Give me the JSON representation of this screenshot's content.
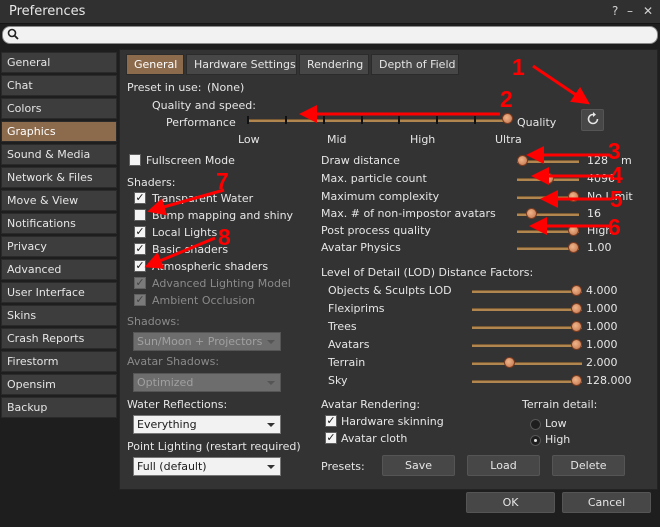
{
  "window": {
    "title": "Preferences",
    "help_glyph": "?",
    "min_glyph": "–",
    "close_glyph": "✕"
  },
  "search": {
    "value": ""
  },
  "sidebar": {
    "items": [
      "General",
      "Chat",
      "Colors",
      "Graphics",
      "Sound & Media",
      "Network & Files",
      "Move & View",
      "Notifications",
      "Privacy",
      "Advanced",
      "User Interface",
      "Skins",
      "Crash Reports",
      "Firestorm",
      "Opensim",
      "Backup"
    ],
    "active_index": 3
  },
  "tabs": [
    "General",
    "Hardware Settings",
    "Rendering",
    "Depth of Field"
  ],
  "preset": {
    "label": "Preset in use:",
    "value": "(None)"
  },
  "quality": {
    "label": "Quality and speed:",
    "left": "Performance",
    "right": "Quality",
    "scale": [
      "Low",
      "Mid",
      "High",
      "Ultra"
    ],
    "level": 7,
    "levels": 7
  },
  "fullscreen": {
    "label": "Fullscreen Mode",
    "checked": false
  },
  "shaders": {
    "label": "Shaders:",
    "items": [
      {
        "label": "Transparent Water",
        "checked": true,
        "enabled": true
      },
      {
        "label": "Bump mapping and shiny",
        "checked": false,
        "enabled": true
      },
      {
        "label": "Local Lights",
        "checked": true,
        "enabled": true
      },
      {
        "label": "Basic shaders",
        "checked": true,
        "enabled": true
      },
      {
        "label": "Atmospheric shaders",
        "checked": true,
        "enabled": true
      },
      {
        "label": "Advanced Lighting Model",
        "checked": true,
        "enabled": false
      },
      {
        "label": "Ambient Occlusion",
        "checked": true,
        "enabled": false
      }
    ]
  },
  "shadows": {
    "label": "Shadows:",
    "value": "Sun/Moon + Projectors"
  },
  "avatar_shadows": {
    "label": "Avatar Shadows:",
    "value": "Optimized"
  },
  "water_reflections": {
    "label": "Water Reflections:",
    "value": "Everything"
  },
  "point_lighting": {
    "label": "Point Lighting (restart required)",
    "value": "Full (default)"
  },
  "right_sliders": [
    {
      "label": "Draw distance",
      "value": "128",
      "unit": "m",
      "fraction": 0.0
    },
    {
      "label": "Max. particle count",
      "value": "4096",
      "fraction": 0.5
    },
    {
      "label": "Maximum complexity",
      "value": "No Limit",
      "fraction": 1.0
    },
    {
      "label": "Max. # of non-impostor avatars",
      "value": "16",
      "fraction": 0.18
    },
    {
      "label": "Post process quality",
      "value": "High",
      "fraction": 1.0
    },
    {
      "label": "Avatar Physics",
      "value": "1.00",
      "fraction": 1.0
    }
  ],
  "lod": {
    "title": "Level of Detail (LOD) Distance Factors:",
    "items": [
      {
        "label": "Objects & Sculpts LOD",
        "value": "4.000",
        "fraction": 1.0
      },
      {
        "label": "Flexiprims",
        "value": "1.000",
        "fraction": 1.0
      },
      {
        "label": "Trees",
        "value": "1.000",
        "fraction": 1.0
      },
      {
        "label": "Avatars",
        "value": "1.000",
        "fraction": 1.0
      },
      {
        "label": "Terrain",
        "value": "2.000",
        "fraction": 0.32
      },
      {
        "label": "Sky",
        "value": "128.000",
        "fraction": 1.0
      }
    ]
  },
  "avatar_rendering": {
    "label": "Avatar Rendering:",
    "items": [
      {
        "label": "Hardware skinning",
        "checked": true
      },
      {
        "label": "Avatar cloth",
        "checked": true
      }
    ]
  },
  "terrain_detail": {
    "label": "Terrain detail:",
    "options": [
      "Low",
      "High"
    ],
    "selected": "High"
  },
  "presets": {
    "label": "Presets:",
    "save": "Save",
    "load": "Load",
    "delete": "Delete"
  },
  "footer": {
    "ok": "OK",
    "cancel": "Cancel"
  },
  "annotations": [
    "1",
    "2",
    "3",
    "4",
    "5",
    "6",
    "7",
    "8"
  ],
  "colors": {
    "accent": "#8c6a4c",
    "slider": "#b2864f",
    "annotation": "#ff0000"
  }
}
